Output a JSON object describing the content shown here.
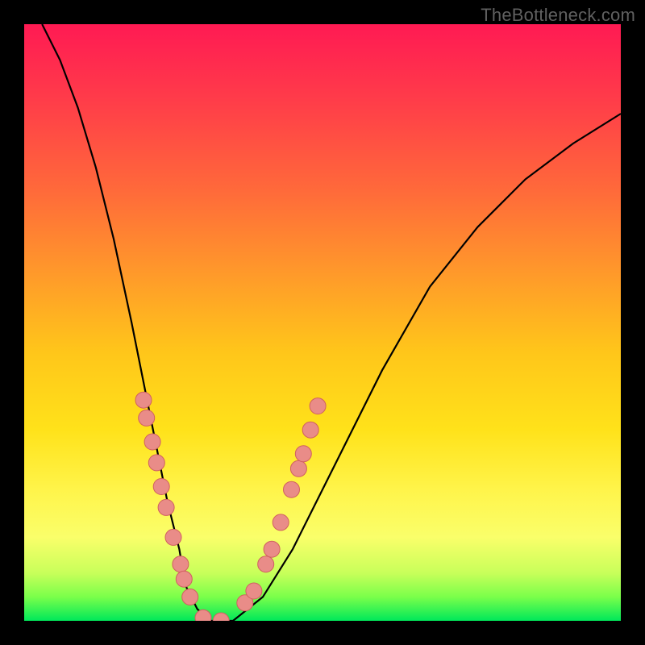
{
  "watermark": "TheBottleneck.com",
  "chart_data": {
    "type": "line",
    "title": "",
    "xlabel": "",
    "ylabel": "",
    "xlim": [
      0,
      1
    ],
    "ylim": [
      0,
      1
    ],
    "series": [
      {
        "name": "curve",
        "x": [
          0.03,
          0.06,
          0.09,
          0.12,
          0.15,
          0.18,
          0.2,
          0.22,
          0.24,
          0.26,
          0.27,
          0.29,
          0.31,
          0.35,
          0.4,
          0.45,
          0.52,
          0.6,
          0.68,
          0.76,
          0.84,
          0.92,
          1.0
        ],
        "y": [
          1.0,
          0.94,
          0.86,
          0.76,
          0.64,
          0.5,
          0.4,
          0.3,
          0.2,
          0.12,
          0.06,
          0.02,
          0.0,
          0.0,
          0.04,
          0.12,
          0.26,
          0.42,
          0.56,
          0.66,
          0.74,
          0.8,
          0.85
        ]
      }
    ],
    "markers_left": [
      {
        "x": 0.2,
        "y": 0.37
      },
      {
        "x": 0.205,
        "y": 0.34
      },
      {
        "x": 0.215,
        "y": 0.3
      },
      {
        "x": 0.222,
        "y": 0.265
      },
      {
        "x": 0.23,
        "y": 0.225
      },
      {
        "x": 0.238,
        "y": 0.19
      },
      {
        "x": 0.25,
        "y": 0.14
      },
      {
        "x": 0.262,
        "y": 0.095
      },
      {
        "x": 0.268,
        "y": 0.07
      },
      {
        "x": 0.278,
        "y": 0.04
      }
    ],
    "markers_right": [
      {
        "x": 0.37,
        "y": 0.03
      },
      {
        "x": 0.385,
        "y": 0.05
      },
      {
        "x": 0.405,
        "y": 0.095
      },
      {
        "x": 0.415,
        "y": 0.12
      },
      {
        "x": 0.43,
        "y": 0.165
      },
      {
        "x": 0.448,
        "y": 0.22
      },
      {
        "x": 0.46,
        "y": 0.255
      },
      {
        "x": 0.468,
        "y": 0.28
      },
      {
        "x": 0.48,
        "y": 0.32
      },
      {
        "x": 0.492,
        "y": 0.36
      }
    ],
    "markers_bottom": [
      {
        "x": 0.3,
        "y": 0.005
      },
      {
        "x": 0.33,
        "y": 0.0
      }
    ],
    "marker_style": {
      "fill": "#e98c88",
      "stroke": "#d06060",
      "radius_px": 10
    }
  }
}
